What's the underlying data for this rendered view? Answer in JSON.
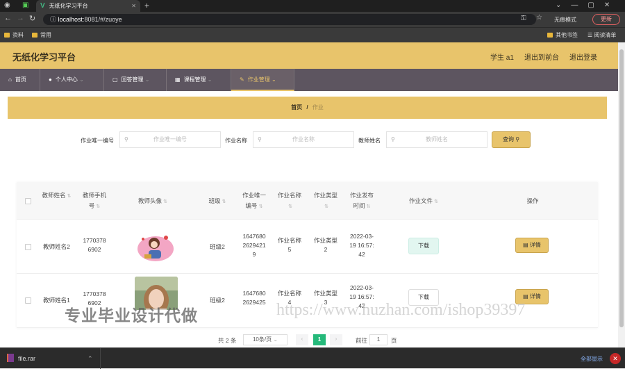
{
  "browser": {
    "tab_title": "无纸化学习平台",
    "url_host": "localhost",
    "url_rest": ":8081/#/zuoye",
    "incognito": "无痕模式",
    "update": "更新",
    "bookmarks": [
      "资料",
      "常用"
    ],
    "other_bookmarks": "其他书签",
    "reading_list": "阅读清单"
  },
  "header": {
    "title": "无纸化学习平台",
    "user": "学生 a1",
    "back": "退出到前台",
    "logout": "退出登录"
  },
  "nav": [
    {
      "label": "首页"
    },
    {
      "label": "个人中心"
    },
    {
      "label": "回答管理"
    },
    {
      "label": "课程管理"
    },
    {
      "label": "作业管理"
    }
  ],
  "breadcrumb": {
    "home": "首页",
    "sep": "/",
    "current": "作业"
  },
  "search": {
    "l1": "作业唯一编号",
    "p1": "作业唯一编号",
    "l2": "作业名称",
    "p2": "作业名称",
    "l3": "教师姓名",
    "p3": "教师姓名",
    "btn": "查询"
  },
  "table": {
    "headers": {
      "h0": "教师姓名",
      "h1a": "教师手机",
      "h1b": "号",
      "h2": "教师头像",
      "h3": "班级",
      "h4a": "作业唯一",
      "h4b": "编号",
      "h5": "作业名称",
      "h6a": "作业类型",
      "h7a": "作业发布",
      "h7b": "时间",
      "h8": "作业文件",
      "h9": "操作"
    },
    "rows": [
      {
        "teacher": "教师姓名2",
        "phone1": "1770378",
        "phone2": "6902",
        "cls": "班级2",
        "id1": "1647680",
        "id2": "2629421",
        "id3": "9",
        "name1": "作业名称",
        "name2": "5",
        "type1": "作业类型",
        "type2": "2",
        "t1": "2022-03-",
        "t2": "19 16:57:",
        "t3": "42",
        "file": "下载",
        "op": "详情"
      },
      {
        "teacher": "教师姓名1",
        "phone1": "1770378",
        "phone2": "6902",
        "cls": "班级2",
        "id1": "1647680",
        "id2": "2629425",
        "id3": "",
        "name1": "作业名称",
        "name2": "4",
        "type1": "作业类型",
        "type2": "3",
        "t1": "2022-03-",
        "t2": "19 16:57:",
        "t3": "42",
        "file": "下载",
        "op": "详情"
      }
    ]
  },
  "pager": {
    "total": "共 2 条",
    "size": "10条/页",
    "page": "1",
    "goto": "前往",
    "goto_val": "1",
    "page_unit": "页"
  },
  "watermark": {
    "left": "专业毕业设计代做",
    "right": "https://www.huzhan.com/ishop39397"
  },
  "downloads": {
    "file": "file.rar",
    "show_all": "全部显示"
  },
  "colors": {
    "accent": "#e8c46b",
    "nav_bg": "#5d5560",
    "dl_green": "#e2f6f0"
  }
}
